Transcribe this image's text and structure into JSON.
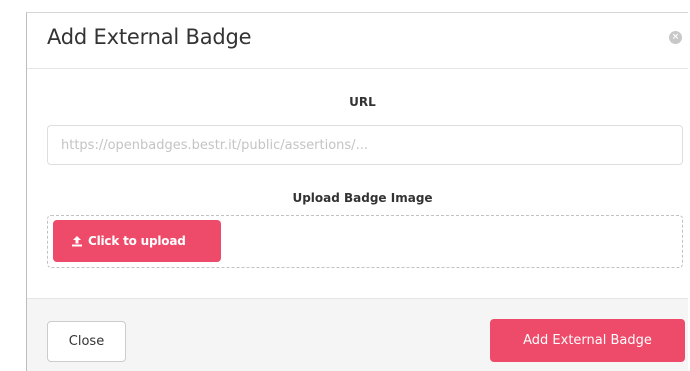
{
  "dialog": {
    "title": "Add External Badge",
    "close_icon": "close-x-icon",
    "close_glyph": "×"
  },
  "url_field": {
    "label": "URL",
    "value": "",
    "placeholder": "https://openbadges.bestr.it/public/assertions/..."
  },
  "upload": {
    "label": "Upload Badge Image",
    "button_label": "Click to upload",
    "icon": "upload-icon"
  },
  "footer": {
    "close_label": "Close",
    "submit_label": "Add External Badge"
  },
  "colors": {
    "accent": "#ee4a6a",
    "footer_bg": "#f5f5f5"
  }
}
